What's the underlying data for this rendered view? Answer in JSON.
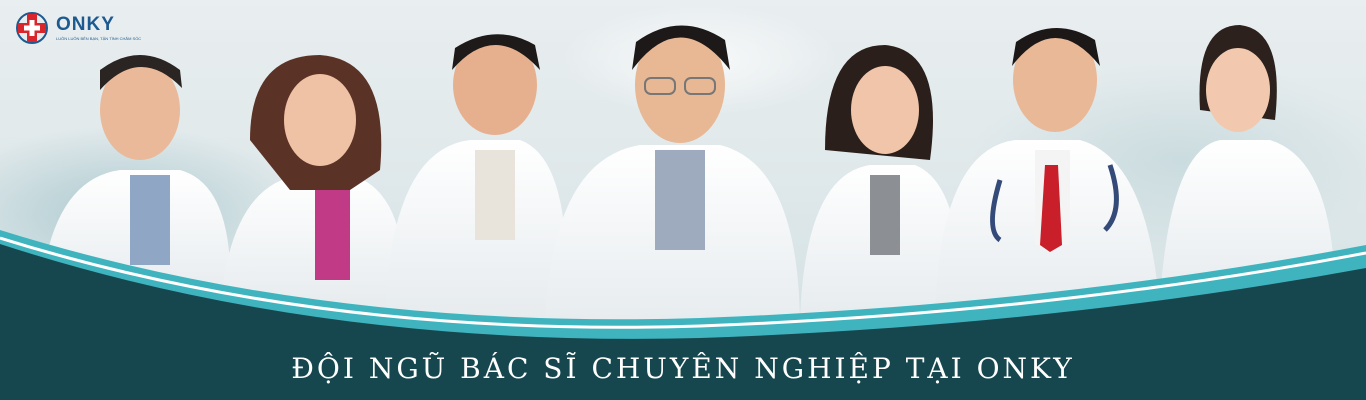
{
  "logo": {
    "brand": "ONKY",
    "tagline": "LUÔN LUÔN BÊN BẠN, TẬN TÌNH CHĂM SÓC",
    "icon": "medical-cross-icon",
    "colors": {
      "cross": "#d8262c",
      "text": "#1c5a8f"
    }
  },
  "headline": "ĐỘI NGŨ BÁC SĨ CHUYÊN NGHIỆP TẠI ONKY",
  "colors": {
    "band": "#16474f",
    "accent_wave": "#3fb4bf",
    "coat": "#f7f8f9"
  }
}
